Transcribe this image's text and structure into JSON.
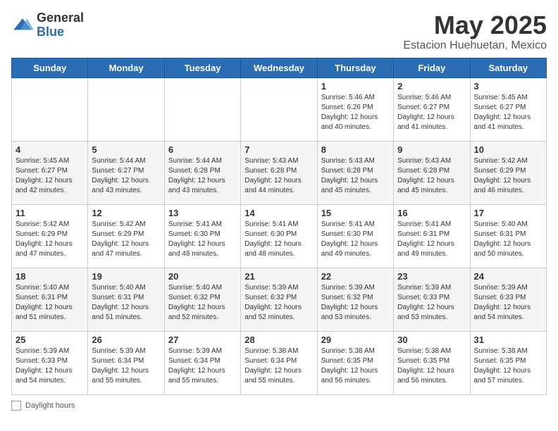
{
  "header": {
    "logo_general": "General",
    "logo_blue": "Blue",
    "month_title": "May 2025",
    "location": "Estacion Huehuetan, Mexico"
  },
  "days_of_week": [
    "Sunday",
    "Monday",
    "Tuesday",
    "Wednesday",
    "Thursday",
    "Friday",
    "Saturday"
  ],
  "weeks": [
    [
      {
        "day": "",
        "info": ""
      },
      {
        "day": "",
        "info": ""
      },
      {
        "day": "",
        "info": ""
      },
      {
        "day": "",
        "info": ""
      },
      {
        "day": "1",
        "info": "Sunrise: 5:46 AM\nSunset: 6:26 PM\nDaylight: 12 hours\nand 40 minutes."
      },
      {
        "day": "2",
        "info": "Sunrise: 5:46 AM\nSunset: 6:27 PM\nDaylight: 12 hours\nand 41 minutes."
      },
      {
        "day": "3",
        "info": "Sunrise: 5:45 AM\nSunset: 6:27 PM\nDaylight: 12 hours\nand 41 minutes."
      }
    ],
    [
      {
        "day": "4",
        "info": "Sunrise: 5:45 AM\nSunset: 6:27 PM\nDaylight: 12 hours\nand 42 minutes."
      },
      {
        "day": "5",
        "info": "Sunrise: 5:44 AM\nSunset: 6:27 PM\nDaylight: 12 hours\nand 43 minutes."
      },
      {
        "day": "6",
        "info": "Sunrise: 5:44 AM\nSunset: 6:28 PM\nDaylight: 12 hours\nand 43 minutes."
      },
      {
        "day": "7",
        "info": "Sunrise: 5:43 AM\nSunset: 6:28 PM\nDaylight: 12 hours\nand 44 minutes."
      },
      {
        "day": "8",
        "info": "Sunrise: 5:43 AM\nSunset: 6:28 PM\nDaylight: 12 hours\nand 45 minutes."
      },
      {
        "day": "9",
        "info": "Sunrise: 5:43 AM\nSunset: 6:28 PM\nDaylight: 12 hours\nand 45 minutes."
      },
      {
        "day": "10",
        "info": "Sunrise: 5:42 AM\nSunset: 6:29 PM\nDaylight: 12 hours\nand 46 minutes."
      }
    ],
    [
      {
        "day": "11",
        "info": "Sunrise: 5:42 AM\nSunset: 6:29 PM\nDaylight: 12 hours\nand 47 minutes."
      },
      {
        "day": "12",
        "info": "Sunrise: 5:42 AM\nSunset: 6:29 PM\nDaylight: 12 hours\nand 47 minutes."
      },
      {
        "day": "13",
        "info": "Sunrise: 5:41 AM\nSunset: 6:30 PM\nDaylight: 12 hours\nand 48 minutes."
      },
      {
        "day": "14",
        "info": "Sunrise: 5:41 AM\nSunset: 6:30 PM\nDaylight: 12 hours\nand 48 minutes."
      },
      {
        "day": "15",
        "info": "Sunrise: 5:41 AM\nSunset: 6:30 PM\nDaylight: 12 hours\nand 49 minutes."
      },
      {
        "day": "16",
        "info": "Sunrise: 5:41 AM\nSunset: 6:31 PM\nDaylight: 12 hours\nand 49 minutes."
      },
      {
        "day": "17",
        "info": "Sunrise: 5:40 AM\nSunset: 6:31 PM\nDaylight: 12 hours\nand 50 minutes."
      }
    ],
    [
      {
        "day": "18",
        "info": "Sunrise: 5:40 AM\nSunset: 6:31 PM\nDaylight: 12 hours\nand 51 minutes."
      },
      {
        "day": "19",
        "info": "Sunrise: 5:40 AM\nSunset: 6:31 PM\nDaylight: 12 hours\nand 51 minutes."
      },
      {
        "day": "20",
        "info": "Sunrise: 5:40 AM\nSunset: 6:32 PM\nDaylight: 12 hours\nand 52 minutes."
      },
      {
        "day": "21",
        "info": "Sunrise: 5:39 AM\nSunset: 6:32 PM\nDaylight: 12 hours\nand 52 minutes."
      },
      {
        "day": "22",
        "info": "Sunrise: 5:39 AM\nSunset: 6:32 PM\nDaylight: 12 hours\nand 53 minutes."
      },
      {
        "day": "23",
        "info": "Sunrise: 5:39 AM\nSunset: 6:33 PM\nDaylight: 12 hours\nand 53 minutes."
      },
      {
        "day": "24",
        "info": "Sunrise: 5:39 AM\nSunset: 6:33 PM\nDaylight: 12 hours\nand 54 minutes."
      }
    ],
    [
      {
        "day": "25",
        "info": "Sunrise: 5:39 AM\nSunset: 6:33 PM\nDaylight: 12 hours\nand 54 minutes."
      },
      {
        "day": "26",
        "info": "Sunrise: 5:39 AM\nSunset: 6:34 PM\nDaylight: 12 hours\nand 55 minutes."
      },
      {
        "day": "27",
        "info": "Sunrise: 5:39 AM\nSunset: 6:34 PM\nDaylight: 12 hours\nand 55 minutes."
      },
      {
        "day": "28",
        "info": "Sunrise: 5:38 AM\nSunset: 6:34 PM\nDaylight: 12 hours\nand 55 minutes."
      },
      {
        "day": "29",
        "info": "Sunrise: 5:38 AM\nSunset: 6:35 PM\nDaylight: 12 hours\nand 56 minutes."
      },
      {
        "day": "30",
        "info": "Sunrise: 5:38 AM\nSunset: 6:35 PM\nDaylight: 12 hours\nand 56 minutes."
      },
      {
        "day": "31",
        "info": "Sunrise: 5:38 AM\nSunset: 6:35 PM\nDaylight: 12 hours\nand 57 minutes."
      }
    ]
  ],
  "footer": {
    "daylight_label": "Daylight hours"
  }
}
